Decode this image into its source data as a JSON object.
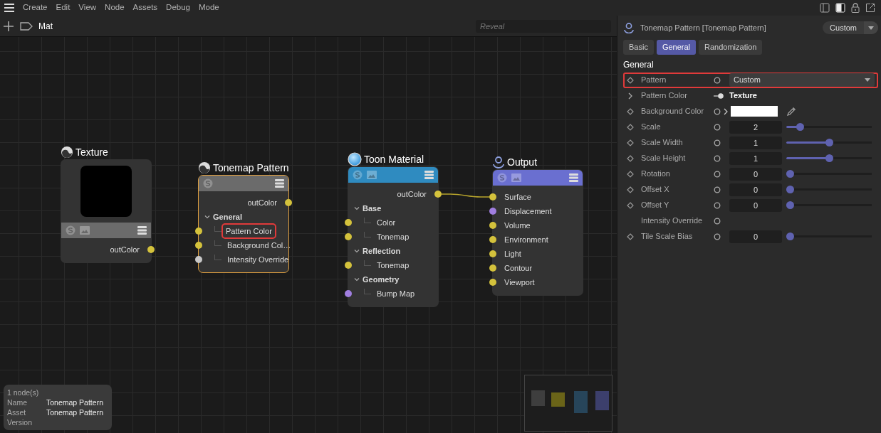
{
  "menu": {
    "items": [
      "Create",
      "Edit",
      "View",
      "Node",
      "Assets",
      "Debug",
      "Mode"
    ]
  },
  "toolbar": {
    "breadcrumb": "Mat",
    "search": {
      "placeholder": "Reveal"
    }
  },
  "nodes": [
    {
      "title": "Texture",
      "image_icon": true,
      "preview": true,
      "selected": false,
      "ports": [
        {
          "kind": "output",
          "label": "outColor",
          "color": "#d4c23c"
        }
      ]
    },
    {
      "title": "Tonemap Pattern",
      "image_icon": false,
      "preview": false,
      "selected": true,
      "ports": [
        {
          "kind": "output",
          "label": "outColor",
          "color": "#d4c23c"
        },
        {
          "kind": "group",
          "label": "General",
          "expanded": true,
          "children": [
            {
              "kind": "input",
              "label": "Pattern Color",
              "color": "#d4c23c",
              "highlighted": true
            },
            {
              "kind": "input",
              "label": "Background Col…",
              "color": "#d4c23c",
              "highlighted": false
            },
            {
              "kind": "input",
              "label": "Intensity Override",
              "color": "#c8c8c8",
              "highlighted": false
            }
          ]
        }
      ]
    },
    {
      "title": "Toon Material",
      "image_icon": true,
      "preview": false,
      "selected": false,
      "ports": [
        {
          "kind": "output",
          "label": "outColor",
          "color": "#d4c23c"
        },
        {
          "kind": "group",
          "label": "Base",
          "expanded": true,
          "children": [
            {
              "kind": "input",
              "label": "Color",
              "color": "#d4c23c",
              "highlighted": false
            },
            {
              "kind": "input",
              "label": "Tonemap",
              "color": "#d4c23c",
              "highlighted": false
            }
          ]
        },
        {
          "kind": "group",
          "label": "Reflection",
          "expanded": true,
          "children": [
            {
              "kind": "input",
              "label": "Tonemap",
              "color": "#d4c23c",
              "highlighted": false
            }
          ]
        },
        {
          "kind": "group",
          "label": "Geometry",
          "expanded": true,
          "children": [
            {
              "kind": "input",
              "label": "Bump Map",
              "color": "#a07ee0",
              "highlighted": false
            }
          ]
        }
      ]
    },
    {
      "title": "Output",
      "image_icon": true,
      "preview": false,
      "selected": false,
      "ports": [
        {
          "kind": "input",
          "label": "Surface",
          "color": "#d4c23c",
          "highlighted": false
        },
        {
          "kind": "input",
          "label": "Displacement",
          "color": "#a07ee0",
          "highlighted": false
        },
        {
          "kind": "input",
          "label": "Volume",
          "color": "#d4c23c",
          "highlighted": false
        },
        {
          "kind": "input",
          "label": "Environment",
          "color": "#d4c23c",
          "highlighted": false
        },
        {
          "kind": "input",
          "label": "Light",
          "color": "#d4c23c",
          "highlighted": false
        },
        {
          "kind": "input",
          "label": "Contour",
          "color": "#d4c23c",
          "highlighted": false
        },
        {
          "kind": "input",
          "label": "Viewport",
          "color": "#d4c23c",
          "highlighted": false
        }
      ]
    }
  ],
  "info": {
    "count": "1 node(s)",
    "rows": [
      {
        "key": "Name",
        "value": "Tonemap Pattern"
      },
      {
        "key": "Asset",
        "value": "Tonemap Pattern"
      },
      {
        "key": "Version"
      }
    ]
  },
  "panel": {
    "title": "Tonemap Pattern [Tonemap Pattern]",
    "preset": "Custom",
    "tabs": [
      {
        "label": "Basic",
        "selected": false
      },
      {
        "label": "General",
        "selected": true
      },
      {
        "label": "Randomization",
        "selected": false
      }
    ],
    "section": "General",
    "params": [
      {
        "kind": "dropdown",
        "keyframe": true,
        "label": "Pattern",
        "value": "Custom",
        "highlighted": true,
        "connected": false
      },
      {
        "kind": "link",
        "expanded": false,
        "label": "Pattern Color",
        "value": "Texture",
        "highlighted": false,
        "connected": true
      },
      {
        "kind": "color",
        "keyframe": true,
        "label": "Background Color",
        "color": "#ffffff",
        "highlighted": false,
        "connected": false
      },
      {
        "kind": "slider",
        "keyframe": true,
        "label": "Scale",
        "value": "2",
        "level": 0.13,
        "highlighted": false,
        "connected": false
      },
      {
        "kind": "slider",
        "keyframe": true,
        "label": "Scale Width",
        "value": "1",
        "level": 0.5,
        "highlighted": false,
        "connected": false
      },
      {
        "kind": "slider",
        "keyframe": true,
        "label": "Scale Height",
        "value": "1",
        "level": 0.5,
        "highlighted": false,
        "connected": false
      },
      {
        "kind": "slider",
        "keyframe": true,
        "label": "Rotation",
        "value": "0",
        "level": 0,
        "highlighted": false,
        "connected": false
      },
      {
        "kind": "slider",
        "keyframe": true,
        "label": "Offset X",
        "value": "0",
        "level": 0,
        "highlighted": false,
        "connected": false
      },
      {
        "kind": "slider",
        "keyframe": true,
        "label": "Offset Y",
        "value": "0",
        "level": 0,
        "highlighted": false,
        "connected": false
      },
      {
        "kind": "none",
        "keyframe": false,
        "label": "Intensity Override",
        "highlighted": false,
        "connected": false
      },
      {
        "kind": "slider",
        "keyframe": true,
        "label": "Tile Scale Bias",
        "value": "0",
        "level": 0,
        "highlighted": false,
        "connected": false
      }
    ]
  }
}
